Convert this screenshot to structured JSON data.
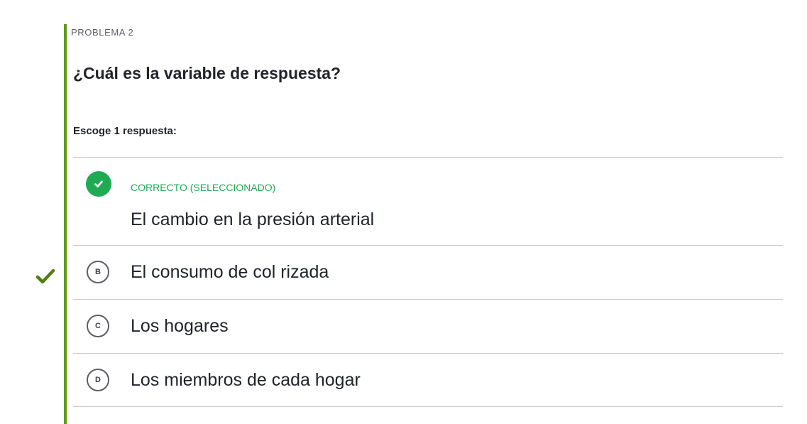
{
  "problem": {
    "eyebrow": "PROBLEMA 2",
    "question": "¿Cuál es la variable de respuesta?",
    "instructions": "Escoge 1 respuesta:"
  },
  "choices": [
    {
      "letter": "A",
      "text": "El cambio en la presión arterial",
      "status": "CORRECTO (SELECCIONADO)",
      "selected": true,
      "correct": true
    },
    {
      "letter": "B",
      "text": "El consumo de col rizada",
      "selected": false
    },
    {
      "letter": "C",
      "text": "Los hogares",
      "selected": false
    },
    {
      "letter": "D",
      "text": "Los miembros de cada hogar",
      "selected": false
    }
  ],
  "icons": {
    "selected_indicator": "check-icon",
    "gutter_mark": "check-icon"
  },
  "colors": {
    "accent_bar": "#5f9a1b",
    "correct": "#1fab54",
    "gutter_check": "#4f7f12",
    "divider": "#c9cacd"
  }
}
